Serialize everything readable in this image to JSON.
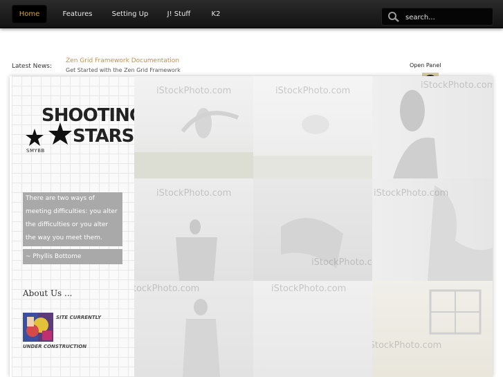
{
  "nav": {
    "items": [
      {
        "label": "Home",
        "active": true
      },
      {
        "label": "Features",
        "active": false
      },
      {
        "label": "Setting Up",
        "active": false
      },
      {
        "label": "J! Stuff",
        "active": false
      },
      {
        "label": "K2",
        "active": false
      }
    ],
    "search_placeholder": "search...",
    "active_color": "#d8a52c"
  },
  "news": {
    "label": "Latest News:",
    "headline": "Zen Grid Framework Documentation",
    "subline": "Get Started with the Zen Grid Framework"
  },
  "panel": {
    "open_label": "Open Panel"
  },
  "logo": {
    "text_line1": "SHOOTING",
    "text_line2": "STARS",
    "subtext": "SMYBB"
  },
  "quote": {
    "text": "There are two ways of meeting difficulties: you alter the difficulties or you alter the way you meet them.",
    "author": "~ Phyllis Bottome"
  },
  "about": {
    "title": "About Us ...",
    "line1": "SITE CURRENTLY",
    "line2": "UNDER CONSTRUCTION"
  },
  "gallery": {
    "watermark": "iStockPhoto.com",
    "tiles": 9
  }
}
